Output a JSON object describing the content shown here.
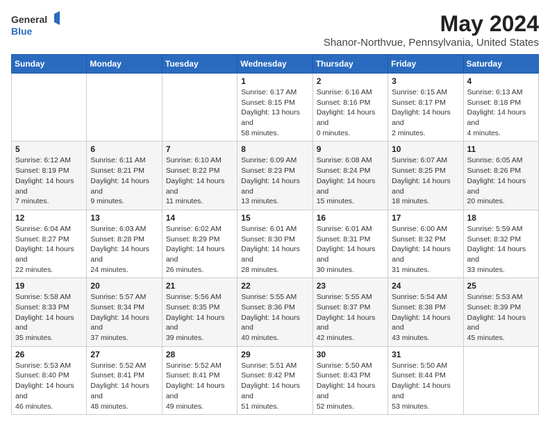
{
  "logo": {
    "general": "General",
    "blue": "Blue"
  },
  "title": "May 2024",
  "subtitle": "Shanor-Northvue, Pennsylvania, United States",
  "days_of_week": [
    "Sunday",
    "Monday",
    "Tuesday",
    "Wednesday",
    "Thursday",
    "Friday",
    "Saturday"
  ],
  "weeks": [
    [
      {
        "day": "",
        "info": ""
      },
      {
        "day": "",
        "info": ""
      },
      {
        "day": "",
        "info": ""
      },
      {
        "day": "1",
        "info": "Sunrise: 6:17 AM\nSunset: 8:15 PM\nDaylight: 13 hours and 58 minutes."
      },
      {
        "day": "2",
        "info": "Sunrise: 6:16 AM\nSunset: 8:16 PM\nDaylight: 14 hours and 0 minutes."
      },
      {
        "day": "3",
        "info": "Sunrise: 6:15 AM\nSunset: 8:17 PM\nDaylight: 14 hours and 2 minutes."
      },
      {
        "day": "4",
        "info": "Sunrise: 6:13 AM\nSunset: 8:18 PM\nDaylight: 14 hours and 4 minutes."
      }
    ],
    [
      {
        "day": "5",
        "info": "Sunrise: 6:12 AM\nSunset: 8:19 PM\nDaylight: 14 hours and 7 minutes."
      },
      {
        "day": "6",
        "info": "Sunrise: 6:11 AM\nSunset: 8:21 PM\nDaylight: 14 hours and 9 minutes."
      },
      {
        "day": "7",
        "info": "Sunrise: 6:10 AM\nSunset: 8:22 PM\nDaylight: 14 hours and 11 minutes."
      },
      {
        "day": "8",
        "info": "Sunrise: 6:09 AM\nSunset: 8:23 PM\nDaylight: 14 hours and 13 minutes."
      },
      {
        "day": "9",
        "info": "Sunrise: 6:08 AM\nSunset: 8:24 PM\nDaylight: 14 hours and 15 minutes."
      },
      {
        "day": "10",
        "info": "Sunrise: 6:07 AM\nSunset: 8:25 PM\nDaylight: 14 hours and 18 minutes."
      },
      {
        "day": "11",
        "info": "Sunrise: 6:05 AM\nSunset: 8:26 PM\nDaylight: 14 hours and 20 minutes."
      }
    ],
    [
      {
        "day": "12",
        "info": "Sunrise: 6:04 AM\nSunset: 8:27 PM\nDaylight: 14 hours and 22 minutes."
      },
      {
        "day": "13",
        "info": "Sunrise: 6:03 AM\nSunset: 8:28 PM\nDaylight: 14 hours and 24 minutes."
      },
      {
        "day": "14",
        "info": "Sunrise: 6:02 AM\nSunset: 8:29 PM\nDaylight: 14 hours and 26 minutes."
      },
      {
        "day": "15",
        "info": "Sunrise: 6:01 AM\nSunset: 8:30 PM\nDaylight: 14 hours and 28 minutes."
      },
      {
        "day": "16",
        "info": "Sunrise: 6:01 AM\nSunset: 8:31 PM\nDaylight: 14 hours and 30 minutes."
      },
      {
        "day": "17",
        "info": "Sunrise: 6:00 AM\nSunset: 8:32 PM\nDaylight: 14 hours and 31 minutes."
      },
      {
        "day": "18",
        "info": "Sunrise: 5:59 AM\nSunset: 8:32 PM\nDaylight: 14 hours and 33 minutes."
      }
    ],
    [
      {
        "day": "19",
        "info": "Sunrise: 5:58 AM\nSunset: 8:33 PM\nDaylight: 14 hours and 35 minutes."
      },
      {
        "day": "20",
        "info": "Sunrise: 5:57 AM\nSunset: 8:34 PM\nDaylight: 14 hours and 37 minutes."
      },
      {
        "day": "21",
        "info": "Sunrise: 5:56 AM\nSunset: 8:35 PM\nDaylight: 14 hours and 39 minutes."
      },
      {
        "day": "22",
        "info": "Sunrise: 5:55 AM\nSunset: 8:36 PM\nDaylight: 14 hours and 40 minutes."
      },
      {
        "day": "23",
        "info": "Sunrise: 5:55 AM\nSunset: 8:37 PM\nDaylight: 14 hours and 42 minutes."
      },
      {
        "day": "24",
        "info": "Sunrise: 5:54 AM\nSunset: 8:38 PM\nDaylight: 14 hours and 43 minutes."
      },
      {
        "day": "25",
        "info": "Sunrise: 5:53 AM\nSunset: 8:39 PM\nDaylight: 14 hours and 45 minutes."
      }
    ],
    [
      {
        "day": "26",
        "info": "Sunrise: 5:53 AM\nSunset: 8:40 PM\nDaylight: 14 hours and 46 minutes."
      },
      {
        "day": "27",
        "info": "Sunrise: 5:52 AM\nSunset: 8:41 PM\nDaylight: 14 hours and 48 minutes."
      },
      {
        "day": "28",
        "info": "Sunrise: 5:52 AM\nSunset: 8:41 PM\nDaylight: 14 hours and 49 minutes."
      },
      {
        "day": "29",
        "info": "Sunrise: 5:51 AM\nSunset: 8:42 PM\nDaylight: 14 hours and 51 minutes."
      },
      {
        "day": "30",
        "info": "Sunrise: 5:50 AM\nSunset: 8:43 PM\nDaylight: 14 hours and 52 minutes."
      },
      {
        "day": "31",
        "info": "Sunrise: 5:50 AM\nSunset: 8:44 PM\nDaylight: 14 hours and 53 minutes."
      },
      {
        "day": "",
        "info": ""
      }
    ]
  ]
}
